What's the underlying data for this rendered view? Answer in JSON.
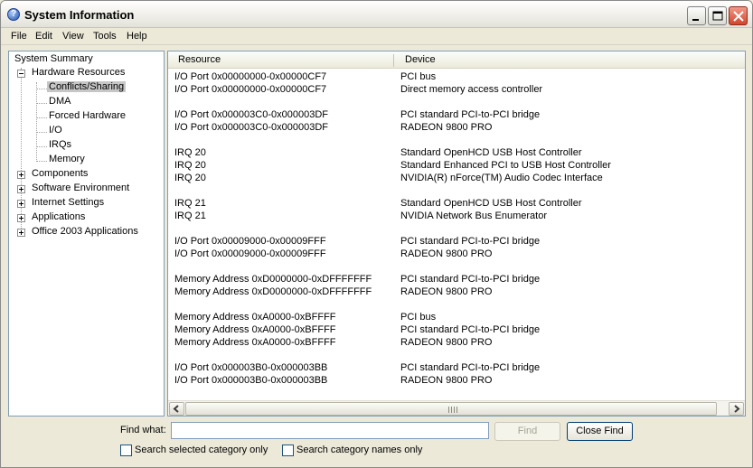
{
  "window": {
    "title": "System Information",
    "icon": "help-question-icon"
  },
  "menu": [
    "File",
    "Edit",
    "View",
    "Tools",
    "Help"
  ],
  "tree": {
    "root": "System Summary",
    "hardware_resources": "Hardware Resources",
    "hardware_children": [
      "Conflicts/Sharing",
      "DMA",
      "Forced Hardware",
      "I/O",
      "IRQs",
      "Memory"
    ],
    "selected": "Conflicts/Sharing",
    "others": [
      "Components",
      "Software Environment",
      "Internet Settings",
      "Applications",
      "Office 2003 Applications"
    ]
  },
  "list": {
    "headers": {
      "resource": "Resource",
      "device": "Device"
    },
    "rows": [
      {
        "resource": "I/O Port 0x00000000-0x00000CF7",
        "device": "PCI bus"
      },
      {
        "resource": "I/O Port 0x00000000-0x00000CF7",
        "device": "Direct memory access controller"
      },
      {
        "resource": "",
        "device": ""
      },
      {
        "resource": "I/O Port 0x000003C0-0x000003DF",
        "device": "PCI standard PCI-to-PCI bridge"
      },
      {
        "resource": "I/O Port 0x000003C0-0x000003DF",
        "device": "RADEON 9800 PRO"
      },
      {
        "resource": "",
        "device": ""
      },
      {
        "resource": "IRQ 20",
        "device": "Standard OpenHCD USB Host Controller"
      },
      {
        "resource": "IRQ 20",
        "device": "Standard Enhanced PCI to USB Host Controller"
      },
      {
        "resource": "IRQ 20",
        "device": "NVIDIA(R) nForce(TM) Audio Codec Interface"
      },
      {
        "resource": "",
        "device": ""
      },
      {
        "resource": "IRQ 21",
        "device": "Standard OpenHCD USB Host Controller"
      },
      {
        "resource": "IRQ 21",
        "device": "NVIDIA Network Bus Enumerator"
      },
      {
        "resource": "",
        "device": ""
      },
      {
        "resource": "I/O Port 0x00009000-0x00009FFF",
        "device": "PCI standard PCI-to-PCI bridge"
      },
      {
        "resource": "I/O Port 0x00009000-0x00009FFF",
        "device": "RADEON 9800 PRO"
      },
      {
        "resource": "",
        "device": ""
      },
      {
        "resource": "Memory Address 0xD0000000-0xDFFFFFFF",
        "device": "PCI standard PCI-to-PCI bridge"
      },
      {
        "resource": "Memory Address 0xD0000000-0xDFFFFFFF",
        "device": "RADEON 9800 PRO"
      },
      {
        "resource": "",
        "device": ""
      },
      {
        "resource": "Memory Address 0xA0000-0xBFFFF",
        "device": "PCI bus"
      },
      {
        "resource": "Memory Address 0xA0000-0xBFFFF",
        "device": "PCI standard PCI-to-PCI bridge"
      },
      {
        "resource": "Memory Address 0xA0000-0xBFFFF",
        "device": "RADEON 9800 PRO"
      },
      {
        "resource": "",
        "device": ""
      },
      {
        "resource": "I/O Port 0x000003B0-0x000003BB",
        "device": "PCI standard PCI-to-PCI bridge"
      },
      {
        "resource": "I/O Port 0x000003B0-0x000003BB",
        "device": "RADEON 9800 PRO"
      }
    ]
  },
  "find": {
    "label": "Find what:",
    "value": "",
    "find_button": "Find",
    "close_find_button": "Close Find",
    "search_selected_label": "Search selected category only",
    "search_names_label": "Search category names only"
  }
}
